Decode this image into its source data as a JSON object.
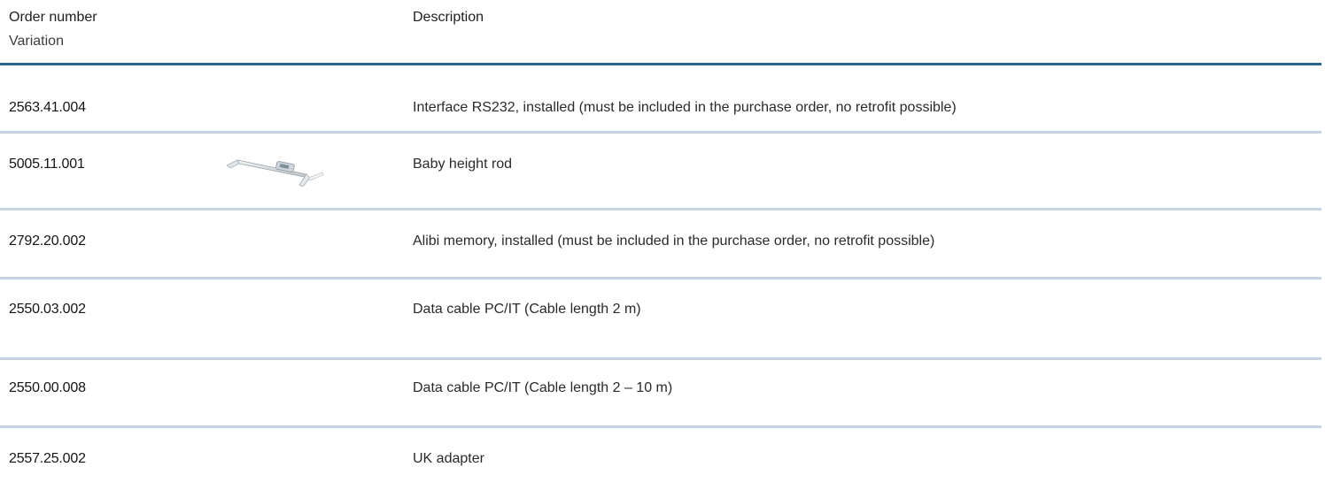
{
  "header": {
    "order_number": "Order number",
    "variation": "Variation",
    "description": "Description"
  },
  "rows": [
    {
      "order": "2563.41.004",
      "description": "Interface RS232, installed (must be included in the purchase order, no retrofit possible)"
    },
    {
      "order": "5005.11.001",
      "description": "Baby height rod",
      "image": "baby-height-rod-image"
    },
    {
      "order": "2792.20.002",
      "description": "Alibi memory, installed (must be included in the purchase order, no retrofit possible)"
    },
    {
      "order": "2550.03.002",
      "description": "Data cable PC/IT (Cable length 2 m)"
    },
    {
      "order": "2550.00.008",
      "description": "Data cable PC/IT (Cable length 2 – 10 m)"
    },
    {
      "order": "2557.25.002",
      "description": "UK adapter"
    }
  ],
  "colors": {
    "header_rule": "#24668f",
    "row_rule": "#c5d3e0"
  }
}
